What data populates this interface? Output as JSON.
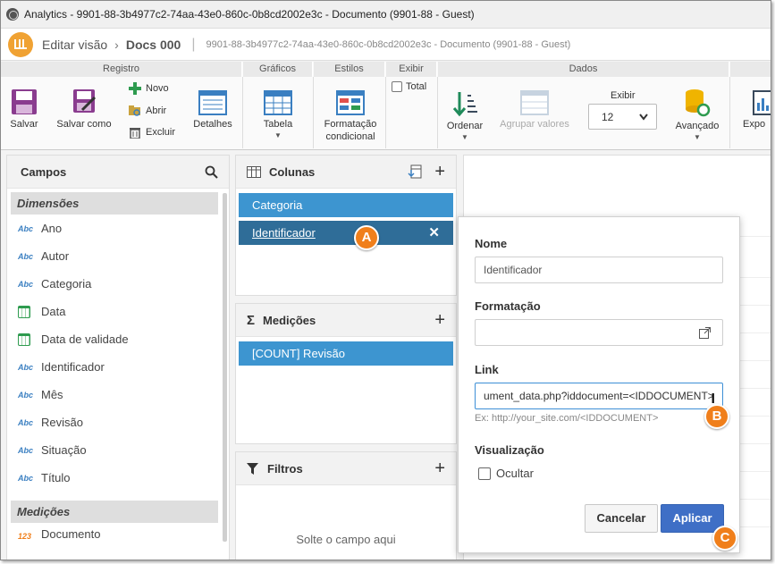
{
  "window": {
    "title": "Analytics - 9901-88-3b4977c2-74aa-43e0-860c-0b8cd2002e3c - Documento (9901-88 - Guest)"
  },
  "header": {
    "crumb1": "Editar visão",
    "crumb2": "Docs 000",
    "crumb3": "9901-88-3b4977c2-74aa-43e0-860c-0b8cd2002e3c - Documento (9901-88 - Guest)"
  },
  "ribbon": {
    "groups": [
      "Registro",
      "Gráficos",
      "Estilos",
      "Exibir",
      "Dados"
    ],
    "salvar": "Salvar",
    "salvar_como": "Salvar como",
    "novo": "Novo",
    "abrir": "Abrir",
    "excluir": "Excluir",
    "detalhes": "Detalhes",
    "tabela": "Tabela",
    "formatacao_l1": "Formatação",
    "formatacao_l2": "condicional",
    "total": "Total",
    "ordenar": "Ordenar",
    "agrupar": "Agrupar valores",
    "exibir_label": "Exibir",
    "exibir_value": "12",
    "avancado": "Avançado",
    "export": "Expo"
  },
  "campos": {
    "title": "Campos",
    "dimensoes": "Dimensões",
    "fields": [
      {
        "label": "Ano",
        "type": "abc"
      },
      {
        "label": "Autor",
        "type": "abc"
      },
      {
        "label": "Categoria",
        "type": "abc"
      },
      {
        "label": "Data",
        "type": "date"
      },
      {
        "label": "Data de validade",
        "type": "date"
      },
      {
        "label": "Identificador",
        "type": "abc"
      },
      {
        "label": "Mês",
        "type": "abc"
      },
      {
        "label": "Revisão",
        "type": "abc"
      },
      {
        "label": "Situação",
        "type": "abc"
      },
      {
        "label": "Título",
        "type": "abc"
      }
    ],
    "abc_label": "Abc",
    "medicoes": "Medições",
    "partial_item": "Documento"
  },
  "colunas": {
    "title": "Colunas",
    "items": [
      "Categoria",
      "Identificador"
    ]
  },
  "medicoes_panel": {
    "title": "Medições",
    "items": [
      "[COUNT] Revisão"
    ]
  },
  "filtros": {
    "title": "Filtros",
    "drop_hint": "Solte o campo aqui"
  },
  "popover": {
    "nome_label": "Nome",
    "nome_value": "Identificador",
    "formatacao_label": "Formatação",
    "formatacao_value": "",
    "link_label": "Link",
    "link_value": "ument_data.php?iddocument=<IDDOCUMENT>",
    "link_hint": "Ex: http://your_site.com/<IDDOCUMENT>",
    "visualizacao_label": "Visualização",
    "ocultar_label": "Ocultar",
    "ocultar_checked": false,
    "cancel": "Cancelar",
    "apply": "Aplicar"
  },
  "markers": {
    "a": "A",
    "b": "B",
    "c": "C"
  },
  "colors": {
    "pill_light": "#3d95d0",
    "pill_dark": "#2f6d98",
    "accent": "#3f6fc6",
    "marker": "#f07f1b",
    "save_purple": "#8a3c8f"
  }
}
